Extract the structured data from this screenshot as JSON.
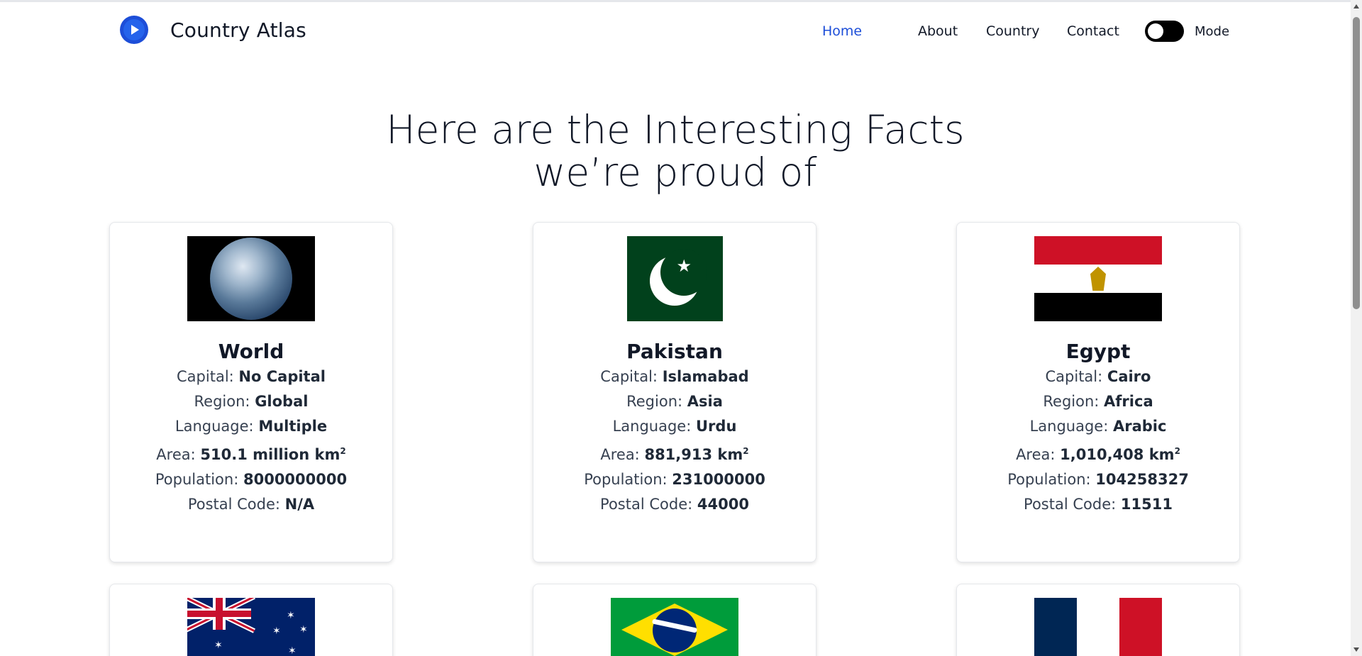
{
  "brand": {
    "name": "Country Atlas",
    "logo_icon": "play-circle-icon"
  },
  "nav": {
    "links": [
      {
        "label": "Home",
        "active": true
      },
      {
        "label": "About",
        "active": false
      },
      {
        "label": "Country",
        "active": false
      },
      {
        "label": "Contact",
        "active": false
      }
    ],
    "mode_label": "Mode"
  },
  "hero": {
    "line1": "Here are the Interesting Facts",
    "line2": "we’re proud of"
  },
  "labels": {
    "capital": "Capital:",
    "region": "Region:",
    "language": "Language:",
    "area": "Area:",
    "population": "Population:",
    "postal": "Postal Code:"
  },
  "cards": [
    {
      "name": "World",
      "capital": "No Capital",
      "region": "Global",
      "language": "Multiple",
      "area": "510.1 million km",
      "population": "8000000000",
      "postal": "N/A"
    },
    {
      "name": "Pakistan",
      "capital": "Islamabad",
      "region": "Asia",
      "language": "Urdu",
      "area": "881,913 km",
      "population": "231000000",
      "postal": "44000"
    },
    {
      "name": "Egypt",
      "capital": "Cairo",
      "region": "Africa",
      "language": "Arabic",
      "area": "1,010,408 km",
      "population": "104258327",
      "postal": "11511"
    }
  ],
  "area_sup": "2",
  "colors": {
    "accent": "#1d4ed8",
    "text": "#111827"
  }
}
